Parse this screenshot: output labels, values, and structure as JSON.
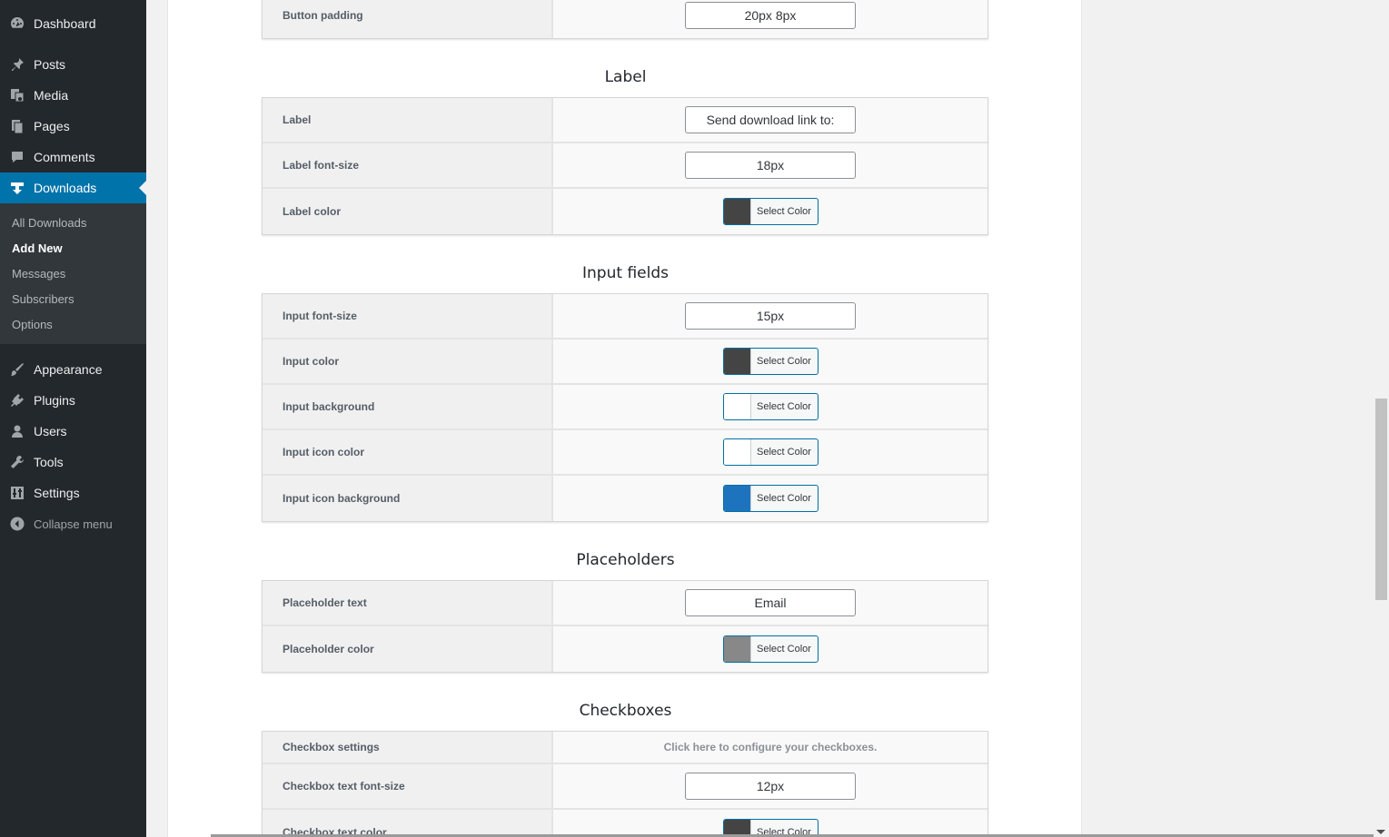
{
  "sidebar": {
    "menu": [
      {
        "label": "Dashboard",
        "icon": "dashboard-icon"
      },
      {
        "label": "Posts",
        "icon": "pushpin-icon"
      },
      {
        "label": "Media",
        "icon": "media-icon"
      },
      {
        "label": "Pages",
        "icon": "pages-icon"
      },
      {
        "label": "Comments",
        "icon": "comments-icon"
      },
      {
        "label": "Downloads",
        "icon": "downloads-icon"
      },
      {
        "label": "Appearance",
        "icon": "paintbrush-icon"
      },
      {
        "label": "Plugins",
        "icon": "plugin-icon"
      },
      {
        "label": "Users",
        "icon": "users-icon"
      },
      {
        "label": "Tools",
        "icon": "wrench-icon"
      },
      {
        "label": "Settings",
        "icon": "settings-sliders-icon"
      }
    ],
    "submenu": [
      "All Downloads",
      "Add New",
      "Messages",
      "Subscribers",
      "Options"
    ],
    "collapse_label": "Collapse menu",
    "accent_color": "#0073aa"
  },
  "sections": {
    "button": {
      "rows": [
        {
          "label": "Button padding",
          "value": "20px 8px"
        }
      ]
    },
    "label": {
      "title": "Label",
      "rows": [
        {
          "label": "Label",
          "value": "Send download link to:"
        },
        {
          "label": "Label font-size",
          "value": "18px"
        },
        {
          "label": "Label color",
          "button": "Select Color",
          "color": "#444444"
        }
      ]
    },
    "input_fields": {
      "title": "Input fields",
      "rows": [
        {
          "label": "Input font-size",
          "value": "15px"
        },
        {
          "label": "Input color",
          "button": "Select Color",
          "color": "#444444"
        },
        {
          "label": "Input background",
          "button": "Select Color",
          "color": "#ffffff"
        },
        {
          "label": "Input icon color",
          "button": "Select Color",
          "color": "#ffffff"
        },
        {
          "label": "Input icon background",
          "button": "Select Color",
          "color": "#1e73be"
        }
      ]
    },
    "placeholders": {
      "title": "Placeholders",
      "rows": [
        {
          "label": "Placeholder text",
          "value": "Email"
        },
        {
          "label": "Placeholder color",
          "button": "Select Color",
          "color": "#888888"
        }
      ]
    },
    "checkboxes": {
      "title": "Checkboxes",
      "rows": [
        {
          "label": "Checkbox settings",
          "link": "Click here to configure your checkboxes."
        },
        {
          "label": "Checkbox text font-size",
          "value": "12px"
        },
        {
          "label": "Checkbox text color",
          "button": "Select Color",
          "color": "#444444"
        }
      ]
    }
  }
}
